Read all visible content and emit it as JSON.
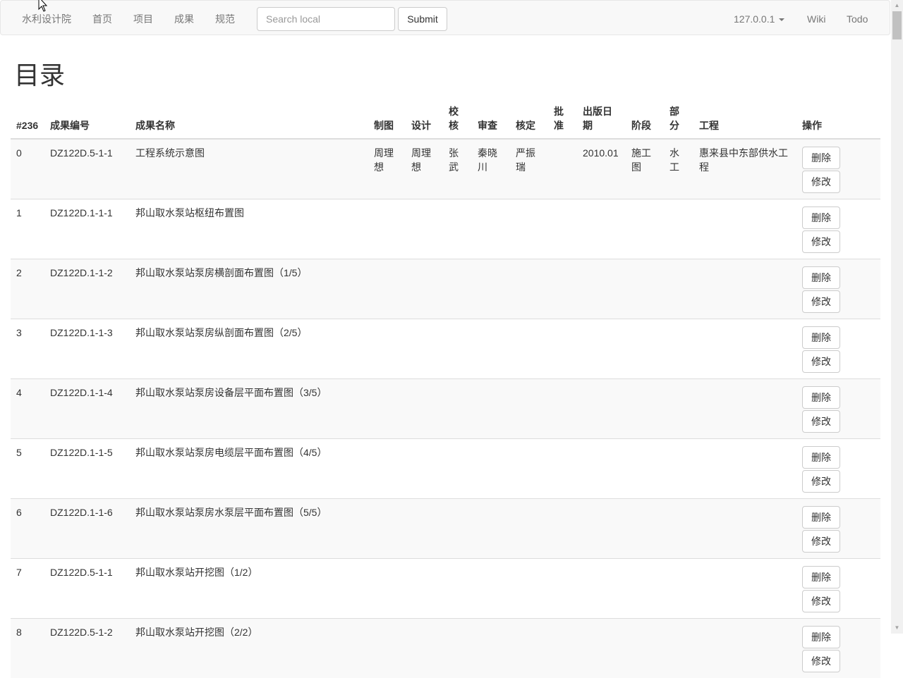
{
  "navbar": {
    "brand": "水利设计院",
    "links": [
      "首页",
      "项目",
      "成果",
      "规范"
    ],
    "search_placeholder": "Search local",
    "submit_label": "Submit",
    "ip_label": "127.0.0.1",
    "wiki_label": "Wiki",
    "todo_label": "Todo"
  },
  "page": {
    "title": "目录"
  },
  "table": {
    "headers": [
      "#236",
      "成果编号",
      "成果名称",
      "制图",
      "设计",
      "校核",
      "审查",
      "核定",
      "批准",
      "出版日期",
      "阶段",
      "部分",
      "工程",
      "操作"
    ],
    "delete_label": "删除",
    "edit_label": "修改",
    "rows": [
      {
        "idx": "0",
        "code": "DZ122D.5-1-1",
        "name": "工程系统示意图",
        "draw": "周理想",
        "design": "周理想",
        "check": "张武",
        "review": "秦晓川",
        "verify": "严振瑞",
        "approve": "",
        "date": "2010.01",
        "stage": "施工图",
        "part": "水工",
        "project": "惠来县中东部供水工程"
      },
      {
        "idx": "1",
        "code": "DZ122D.1-1-1",
        "name": "邦山取水泵站枢纽布置图",
        "draw": "",
        "design": "",
        "check": "",
        "review": "",
        "verify": "",
        "approve": "",
        "date": "",
        "stage": "",
        "part": "",
        "project": ""
      },
      {
        "idx": "2",
        "code": "DZ122D.1-1-2",
        "name": "邦山取水泵站泵房横剖面布置图（1/5）",
        "draw": "",
        "design": "",
        "check": "",
        "review": "",
        "verify": "",
        "approve": "",
        "date": "",
        "stage": "",
        "part": "",
        "project": ""
      },
      {
        "idx": "3",
        "code": "DZ122D.1-1-3",
        "name": "邦山取水泵站泵房纵剖面布置图（2/5）",
        "draw": "",
        "design": "",
        "check": "",
        "review": "",
        "verify": "",
        "approve": "",
        "date": "",
        "stage": "",
        "part": "",
        "project": ""
      },
      {
        "idx": "4",
        "code": "DZ122D.1-1-4",
        "name": "邦山取水泵站泵房设备层平面布置图（3/5）",
        "draw": "",
        "design": "",
        "check": "",
        "review": "",
        "verify": "",
        "approve": "",
        "date": "",
        "stage": "",
        "part": "",
        "project": ""
      },
      {
        "idx": "5",
        "code": "DZ122D.1-1-5",
        "name": "邦山取水泵站泵房电缆层平面布置图（4/5）",
        "draw": "",
        "design": "",
        "check": "",
        "review": "",
        "verify": "",
        "approve": "",
        "date": "",
        "stage": "",
        "part": "",
        "project": ""
      },
      {
        "idx": "6",
        "code": "DZ122D.1-1-6",
        "name": "邦山取水泵站泵房水泵层平面布置图（5/5）",
        "draw": "",
        "design": "",
        "check": "",
        "review": "",
        "verify": "",
        "approve": "",
        "date": "",
        "stage": "",
        "part": "",
        "project": ""
      },
      {
        "idx": "7",
        "code": "DZ122D.5-1-1",
        "name": "邦山取水泵站开挖图（1/2）",
        "draw": "",
        "design": "",
        "check": "",
        "review": "",
        "verify": "",
        "approve": "",
        "date": "",
        "stage": "",
        "part": "",
        "project": ""
      },
      {
        "idx": "8",
        "code": "DZ122D.5-1-2",
        "name": "邦山取水泵站开挖图（2/2）",
        "draw": "",
        "design": "",
        "check": "",
        "review": "",
        "verify": "",
        "approve": "",
        "date": "",
        "stage": "",
        "part": "",
        "project": ""
      }
    ]
  }
}
